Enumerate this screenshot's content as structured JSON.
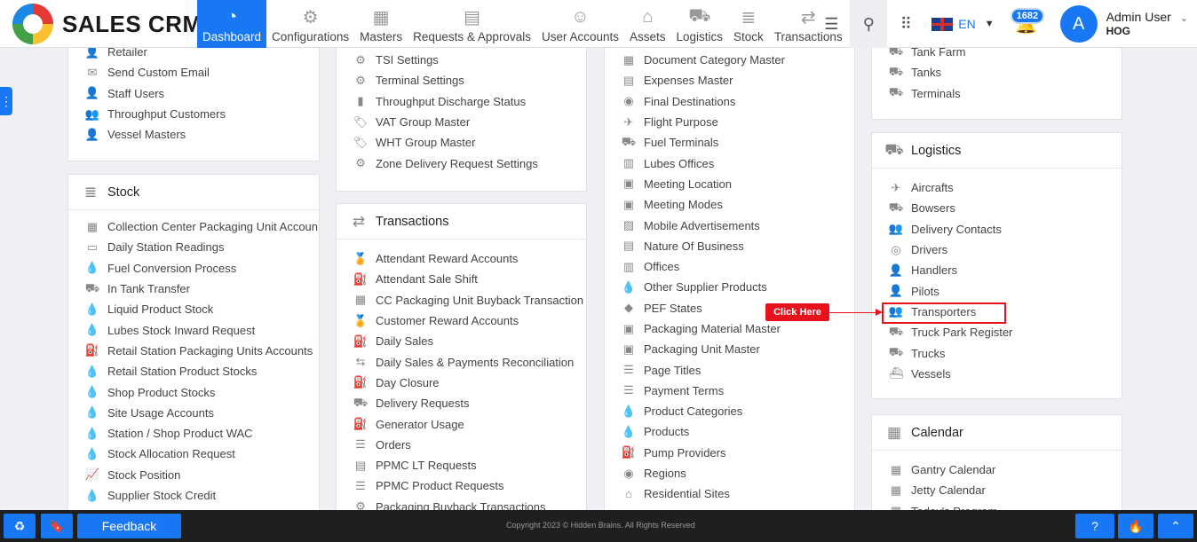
{
  "brand": {
    "name": "SALES CRM"
  },
  "nav": [
    {
      "label": "Dashboard",
      "icon": "dashboard-gauge-icon",
      "glyph": "◔",
      "active": true
    },
    {
      "label": "Configurations",
      "icon": "gears-icon",
      "glyph": "⚙",
      "active": false
    },
    {
      "label": "Masters",
      "icon": "masters-grid-icon",
      "glyph": "▦",
      "active": false
    },
    {
      "label": "Requests & Approvals",
      "icon": "document-check-icon",
      "glyph": "▤",
      "active": false
    },
    {
      "label": "User Accounts",
      "icon": "user-group-icon",
      "glyph": "☺",
      "active": false
    },
    {
      "label": "Assets",
      "icon": "factory-icon",
      "glyph": "⌂",
      "active": false
    },
    {
      "label": "Logistics",
      "icon": "bus-icon",
      "glyph": "⛟",
      "active": false
    },
    {
      "label": "Stock",
      "icon": "stack-icon",
      "glyph": "≣",
      "active": false
    },
    {
      "label": "Transactions",
      "icon": "transfer-arrows-icon",
      "glyph": "⇄",
      "active": false
    }
  ],
  "header": {
    "language": "EN",
    "notification_count": "1682",
    "user_initial": "A",
    "user_name": "Admin User",
    "user_role": "HOG"
  },
  "panels": {
    "col1_top": {
      "items": [
        {
          "label": "Retailer",
          "icon": "user-icon",
          "glyph": "👤"
        },
        {
          "label": "Send Custom Email",
          "icon": "envelope-icon",
          "glyph": "✉"
        },
        {
          "label": "Staff Users",
          "icon": "user-icon",
          "glyph": "👤"
        },
        {
          "label": "Throughput Customers",
          "icon": "user-group-icon",
          "glyph": "👥"
        },
        {
          "label": "Vessel Masters",
          "icon": "captain-icon",
          "glyph": "👤"
        }
      ]
    },
    "stock": {
      "title": "Stock",
      "icon": "stack-icon",
      "glyph": "≣",
      "items": [
        {
          "label": "Collection Center Packaging Unit Accoun",
          "icon": "boxes-icon",
          "glyph": "▦"
        },
        {
          "label": "Daily Station Readings",
          "icon": "meter-984-icon",
          "glyph": "▭"
        },
        {
          "label": "Fuel Conversion Process",
          "icon": "droplet-icon",
          "glyph": "💧"
        },
        {
          "label": "In Tank Transfer",
          "icon": "tank-truck-icon",
          "glyph": "⛟"
        },
        {
          "label": "Liquid Product Stock",
          "icon": "droplet-icon",
          "glyph": "💧"
        },
        {
          "label": "Lubes Stock Inward Request",
          "icon": "droplet-icon",
          "glyph": "💧"
        },
        {
          "label": "Retail Station Packaging Units Accounts",
          "icon": "fuel-pump-icon",
          "glyph": "⛽"
        },
        {
          "label": "Retail Station Product Stocks",
          "icon": "droplet-icon",
          "glyph": "💧"
        },
        {
          "label": "Shop Product Stocks",
          "icon": "droplet-icon",
          "glyph": "💧"
        },
        {
          "label": "Site Usage Accounts",
          "icon": "droplet-icon",
          "glyph": "💧"
        },
        {
          "label": "Station / Shop Product WAC",
          "icon": "droplet-icon",
          "glyph": "💧"
        },
        {
          "label": "Stock Allocation Request",
          "icon": "droplet-icon",
          "glyph": "💧"
        },
        {
          "label": "Stock Position",
          "icon": "chart-line-icon",
          "glyph": "📈"
        },
        {
          "label": "Supplier Stock Credit",
          "icon": "droplet-icon",
          "glyph": "💧"
        }
      ]
    },
    "col2_top": {
      "items": [
        {
          "label": "TSI Settings",
          "icon": "gears-icon",
          "glyph": "⚙"
        },
        {
          "label": "Terminal Settings",
          "icon": "gear-icon",
          "glyph": "⚙"
        },
        {
          "label": "Throughput Discharge Status",
          "icon": "file-icon",
          "glyph": "▮"
        },
        {
          "label": "VAT Group Master",
          "icon": "tag-icon",
          "glyph": "🏷"
        },
        {
          "label": "WHT Group Master",
          "icon": "tag-icon",
          "glyph": "🏷"
        },
        {
          "label": "Zone Delivery Request Settings",
          "icon": "gears-icon",
          "glyph": "⚙"
        }
      ]
    },
    "transactions": {
      "title": "Transactions",
      "icon": "transfer-arrows-icon",
      "glyph": "⇄",
      "items": [
        {
          "label": "Attendant Reward Accounts",
          "icon": "award-icon",
          "glyph": "🏅"
        },
        {
          "label": "Attendant Sale Shift",
          "icon": "fuel-pump-icon",
          "glyph": "⛽"
        },
        {
          "label": "CC Packaging Unit Buyback Transaction",
          "icon": "boxes-icon",
          "glyph": "▦"
        },
        {
          "label": "Customer Reward Accounts",
          "icon": "award-icon",
          "glyph": "🏅"
        },
        {
          "label": "Daily Sales",
          "icon": "fuel-pump-icon",
          "glyph": "⛽"
        },
        {
          "label": "Daily Sales & Payments Reconciliation",
          "icon": "swap-arrows-icon",
          "glyph": "⇆"
        },
        {
          "label": "Day Closure",
          "icon": "fuel-pump-icon",
          "glyph": "⛽"
        },
        {
          "label": "Delivery Requests",
          "icon": "truck-icon",
          "glyph": "⛟"
        },
        {
          "label": "Generator Usage",
          "icon": "fuel-pump-icon",
          "glyph": "⛽"
        },
        {
          "label": "Orders",
          "icon": "list-icon",
          "glyph": "☰"
        },
        {
          "label": "PPMC LT Requests",
          "icon": "document-icon",
          "glyph": "▤"
        },
        {
          "label": "PPMC Product Requests",
          "icon": "list-icon",
          "glyph": "☰"
        },
        {
          "label": "Packaging Buyback Transactions",
          "icon": "gears-icon",
          "glyph": "⚙"
        }
      ]
    },
    "masters": {
      "items": [
        {
          "label": "Document Category Master",
          "icon": "building-icon",
          "glyph": "▦"
        },
        {
          "label": "Expenses Master",
          "icon": "document-icon",
          "glyph": "▤"
        },
        {
          "label": "Final Destinations",
          "icon": "location-icon",
          "glyph": "◉"
        },
        {
          "label": "Flight Purpose",
          "icon": "airplane-icon",
          "glyph": "✈"
        },
        {
          "label": "Fuel Terminals",
          "icon": "tank-truck-icon",
          "glyph": "⛟"
        },
        {
          "label": "Lubes Offices",
          "icon": "buildings-icon",
          "glyph": "▥"
        },
        {
          "label": "Meeting Location",
          "icon": "meeting-icon",
          "glyph": "▣"
        },
        {
          "label": "Meeting Modes",
          "icon": "meeting-icon",
          "glyph": "▣"
        },
        {
          "label": "Mobile Advertisements",
          "icon": "image-icon",
          "glyph": "▨"
        },
        {
          "label": "Nature Of Business",
          "icon": "document-icon",
          "glyph": "▤"
        },
        {
          "label": "Offices",
          "icon": "buildings-icon",
          "glyph": "▥"
        },
        {
          "label": "Other Supplier Products",
          "icon": "droplet-icon",
          "glyph": "💧"
        },
        {
          "label": "PEF States",
          "icon": "map-icon",
          "glyph": "◆"
        },
        {
          "label": "Packaging Material Master",
          "icon": "box-icon",
          "glyph": "▣"
        },
        {
          "label": "Packaging Unit Master",
          "icon": "box-icon",
          "glyph": "▣"
        },
        {
          "label": "Page Titles",
          "icon": "list-icon",
          "glyph": "☰"
        },
        {
          "label": "Payment Terms",
          "icon": "list-icon",
          "glyph": "☰"
        },
        {
          "label": "Product Categories",
          "icon": "droplet-icon",
          "glyph": "💧"
        },
        {
          "label": "Products",
          "icon": "droplet-icon",
          "glyph": "💧"
        },
        {
          "label": "Pump Providers",
          "icon": "pump-icon",
          "glyph": "⛽"
        },
        {
          "label": "Regions",
          "icon": "location-icon",
          "glyph": "◉"
        },
        {
          "label": "Residential Sites",
          "icon": "home-icon",
          "glyph": "⌂"
        }
      ]
    },
    "col4_top": {
      "items": [
        {
          "label": "Tank Farm",
          "icon": "tank-truck-icon",
          "glyph": "⛟"
        },
        {
          "label": "Tanks",
          "icon": "tank-truck-icon",
          "glyph": "⛟"
        },
        {
          "label": "Terminals",
          "icon": "tank-truck-icon",
          "glyph": "⛟"
        }
      ]
    },
    "logistics": {
      "title": "Logistics",
      "icon": "bus-icon",
      "glyph": "⛟",
      "items": [
        {
          "label": "Aircrafts",
          "icon": "airplane-icon",
          "glyph": "✈"
        },
        {
          "label": "Bowsers",
          "icon": "tank-truck-icon",
          "glyph": "⛟"
        },
        {
          "label": "Delivery Contacts",
          "icon": "user-group-icon",
          "glyph": "👥"
        },
        {
          "label": "Drivers",
          "icon": "steering-wheel-icon",
          "glyph": "◎"
        },
        {
          "label": "Handlers",
          "icon": "user-icon",
          "glyph": "👤"
        },
        {
          "label": "Pilots",
          "icon": "pilot-icon",
          "glyph": "👤"
        },
        {
          "label": "Transporters",
          "icon": "user-group-icon",
          "glyph": "👥"
        },
        {
          "label": "Truck Park Register",
          "icon": "truck-icon",
          "glyph": "⛟"
        },
        {
          "label": "Trucks",
          "icon": "truck-icon",
          "glyph": "⛟"
        },
        {
          "label": "Vessels",
          "icon": "ship-icon",
          "glyph": "⛴"
        }
      ]
    },
    "calendar": {
      "title": "Calendar",
      "icon": "calendar-icon",
      "glyph": "▦",
      "items": [
        {
          "label": "Gantry Calendar",
          "icon": "calendar-icon",
          "glyph": "▦"
        },
        {
          "label": "Jetty Calendar",
          "icon": "calendar-icon",
          "glyph": "▦"
        },
        {
          "label": "Today's Program",
          "icon": "calendar-icon",
          "glyph": "▦"
        }
      ]
    }
  },
  "annotation": {
    "callout_label": "Click Here",
    "color": "#e8121d"
  },
  "footer": {
    "feedback_label": "Feedback",
    "copyright": "Copyright 2023 © Hidden Brains. All Rights Reserved"
  },
  "colors": {
    "primary": "#1877f2",
    "footer_bg": "#1f1f1f",
    "page_bg": "#eef0f4"
  }
}
